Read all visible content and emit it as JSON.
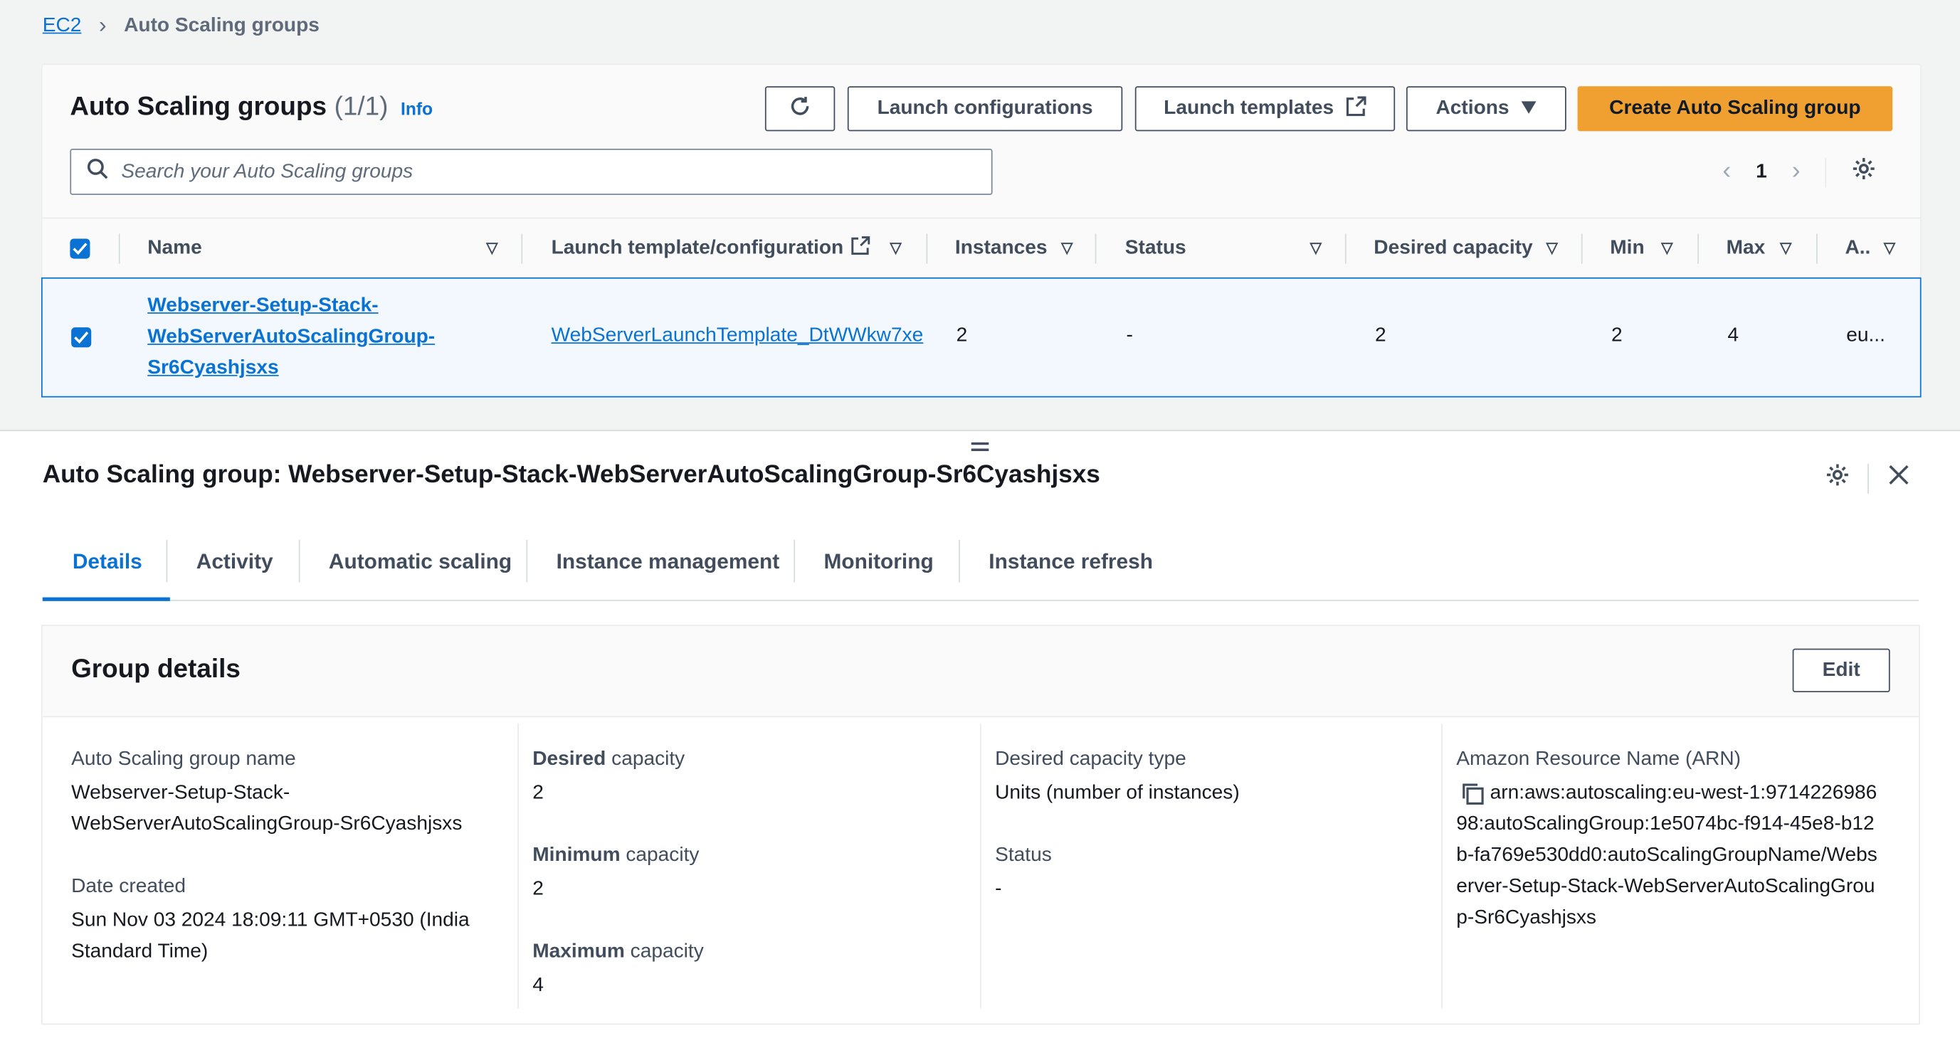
{
  "breadcrumb": {
    "root": "EC2",
    "current": "Auto Scaling groups"
  },
  "list": {
    "title": "Auto Scaling groups",
    "count": "(1/1)",
    "info_label": "Info",
    "buttons": {
      "launch_configurations": "Launch configurations",
      "launch_templates": "Launch templates",
      "actions": "Actions",
      "create": "Create Auto Scaling group"
    },
    "search_placeholder": "Search your Auto Scaling groups",
    "page": "1",
    "columns": {
      "name": "Name",
      "launch_template": "Launch template/configuration",
      "instances": "Instances",
      "status": "Status",
      "desired": "Desired capacity",
      "min": "Min",
      "max": "Max",
      "az": "A.."
    },
    "row": {
      "name_line1": "Webserver-Setup-Stack-",
      "name_line2": "WebServerAutoScalingGroup-",
      "name_line3": "Sr6Cyashjsxs",
      "launch_template": "WebServerLaunchTemplate_DtWWkw7xe",
      "instances": "2",
      "status": "-",
      "desired": "2",
      "min": "2",
      "max": "4",
      "az": "eu..."
    }
  },
  "detail": {
    "title": "Auto Scaling group: Webserver-Setup-Stack-WebServerAutoScalingGroup-Sr6Cyashjsxs",
    "tabs": [
      "Details",
      "Activity",
      "Automatic scaling",
      "Instance management",
      "Monitoring",
      "Instance refresh"
    ],
    "group_details_title": "Group details",
    "edit_label": "Edit",
    "fields": {
      "asg_name_label": "Auto Scaling group name",
      "asg_name_line1": "Webserver-Setup-Stack-",
      "asg_name_line2": "WebServerAutoScalingGroup-Sr6Cyashjsxs",
      "date_created_label": "Date created",
      "date_created_line1": "Sun Nov 03 2024 18:09:11 GMT+0530 (India",
      "date_created_line2": "Standard Time)",
      "desired_label_bold": "Desired",
      "desired_label_rest": " capacity",
      "desired_value": "2",
      "min_label_bold": "Minimum",
      "min_label_rest": " capacity",
      "min_value": "2",
      "max_label_bold": "Maximum",
      "max_label_rest": " capacity",
      "max_value": "4",
      "capacity_type_label": "Desired capacity type",
      "capacity_type_value": "Units (number of instances)",
      "status_label": "Status",
      "status_value": "-",
      "arn_label": "Amazon Resource Name (ARN)",
      "arn_line1": "arn:aws:autoscaling:eu-west-1:9714226986",
      "arn_line2": "98:autoScalingGroup:1e5074bc-f914-45e8-b12",
      "arn_line3": "b-fa769e530dd0:autoScalingGroupName/Webs",
      "arn_line4": "erver-Setup-Stack-WebServerAutoScalingGrou",
      "arn_line5": "p-Sr6Cyashjsxs"
    }
  },
  "colors": {
    "accent": "#0972d3",
    "primary_button": "#f0a030",
    "selected_row_bg": "#f2f8fd"
  }
}
